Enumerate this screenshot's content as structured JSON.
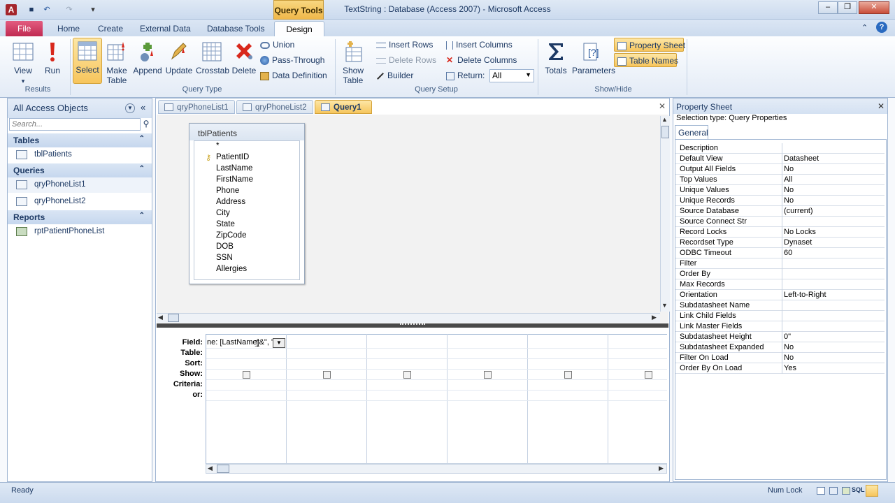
{
  "window": {
    "title": "TextString : Database (Access 2007) - Microsoft Access",
    "context_tab": "Query Tools"
  },
  "ribbon_tabs": [
    "File",
    "Home",
    "Create",
    "External Data",
    "Database Tools",
    "Design"
  ],
  "ribbon": {
    "results": {
      "label": "Results",
      "view": "View",
      "run": "Run"
    },
    "query_type": {
      "label": "Query Type",
      "select": "Select",
      "make_table": [
        "Make",
        "Table"
      ],
      "append": "Append",
      "update": "Update",
      "crosstab": "Crosstab",
      "delete": "Delete",
      "union": "Union",
      "pass_through": "Pass-Through",
      "data_definition": "Data Definition"
    },
    "query_setup": {
      "label": "Query Setup",
      "show_table": [
        "Show",
        "Table"
      ],
      "insert_rows": "Insert Rows",
      "delete_rows": "Delete Rows",
      "builder": "Builder",
      "insert_columns": "Insert Columns",
      "delete_columns": "Delete Columns",
      "return_label": "Return:",
      "return_value": "All"
    },
    "show_hide": {
      "label": "Show/Hide",
      "totals": "Totals",
      "parameters": "Parameters",
      "property_sheet": "Property Sheet",
      "table_names": "Table Names"
    }
  },
  "nav": {
    "title": "All Access Objects",
    "search_placeholder": "Search...",
    "sections": [
      {
        "label": "Tables",
        "items": [
          "tblPatients"
        ]
      },
      {
        "label": "Queries",
        "items": [
          "qryPhoneList1",
          "qryPhoneList2"
        ]
      },
      {
        "label": "Reports",
        "items": [
          "rptPatientPhoneList"
        ]
      }
    ]
  },
  "doc_tabs": [
    "qryPhoneList1",
    "qryPhoneList2",
    "Query1"
  ],
  "field_list": {
    "title": "tblPatients",
    "fields": [
      "*",
      "PatientID",
      "LastName",
      "FirstName",
      "Phone",
      "Address",
      "City",
      "State",
      "ZipCode",
      "DOB",
      "SSN",
      "Allergies"
    ]
  },
  "grid": {
    "row_labels": [
      "Field:",
      "Table:",
      "Sort:",
      "Show:",
      "Criteria:",
      "or:"
    ],
    "field1": "ne: [LastName]&\", \""
  },
  "property_sheet": {
    "title": "Property Sheet",
    "selection_label": "Selection type:",
    "selection_value": "Query Properties",
    "tab": "General",
    "rows": [
      [
        "Description",
        ""
      ],
      [
        "Default View",
        "Datasheet"
      ],
      [
        "Output All Fields",
        "No"
      ],
      [
        "Top Values",
        "All"
      ],
      [
        "Unique Values",
        "No"
      ],
      [
        "Unique Records",
        "No"
      ],
      [
        "Source Database",
        "(current)"
      ],
      [
        "Source Connect Str",
        ""
      ],
      [
        "Record Locks",
        "No Locks"
      ],
      [
        "Recordset Type",
        "Dynaset"
      ],
      [
        "ODBC Timeout",
        "60"
      ],
      [
        "Filter",
        ""
      ],
      [
        "Order By",
        ""
      ],
      [
        "Max Records",
        ""
      ],
      [
        "Orientation",
        "Left-to-Right"
      ],
      [
        "Subdatasheet Name",
        ""
      ],
      [
        "Link Child Fields",
        ""
      ],
      [
        "Link Master Fields",
        ""
      ],
      [
        "Subdatasheet Height",
        "0\""
      ],
      [
        "Subdatasheet Expanded",
        "No"
      ],
      [
        "Filter On Load",
        "No"
      ],
      [
        "Order By On Load",
        "Yes"
      ]
    ]
  },
  "status": {
    "left": "Ready",
    "num_lock": "Num Lock",
    "sql": "SQL"
  }
}
